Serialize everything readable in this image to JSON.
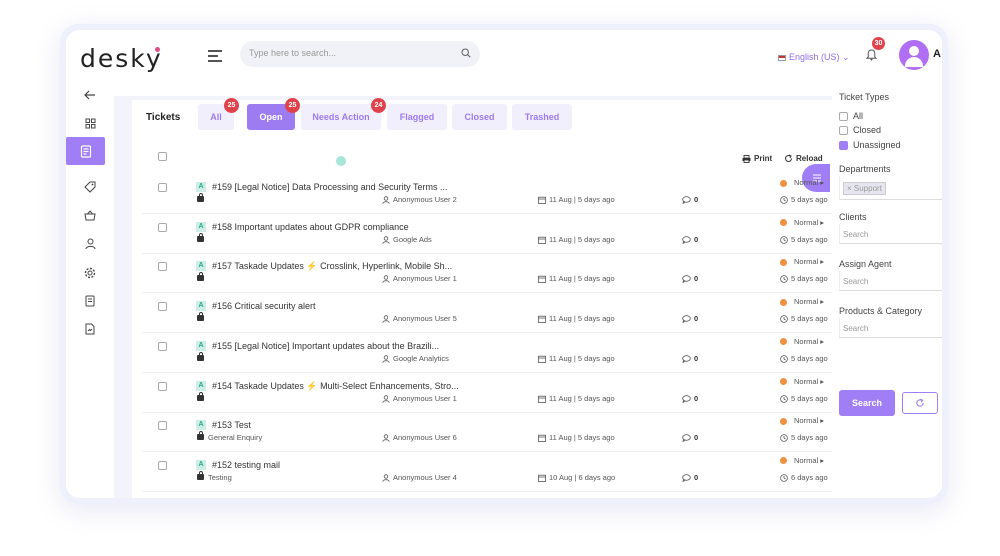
{
  "app": {
    "logo": "desky"
  },
  "header": {
    "search_placeholder": "Type here to search...",
    "language": "English (US)",
    "notification_count": "30",
    "user_initial": "A"
  },
  "tabs": {
    "label": "Tickets",
    "items": [
      {
        "label": "All",
        "badge": "25",
        "active": false
      },
      {
        "label": "Open",
        "badge": "25",
        "active": true
      },
      {
        "label": "Needs Action",
        "badge": "24",
        "active": false
      },
      {
        "label": "Flagged",
        "badge": "",
        "active": false
      },
      {
        "label": "Closed",
        "badge": "",
        "active": false
      },
      {
        "label": "Trashed",
        "badge": "",
        "active": false
      }
    ]
  },
  "toolbar": {
    "print": "Print",
    "reload": "Reload"
  },
  "tickets": [
    {
      "badge": "A",
      "title": "#159 [Legal Notice] Data Processing and Security Terms ...",
      "sub": "",
      "user": "Anonymous User 2",
      "date": "11 Aug | 5 days ago",
      "comments": "0",
      "priority": "Normal",
      "age": "5 days ago"
    },
    {
      "badge": "A",
      "title": "#158 Important updates about GDPR compliance",
      "sub": "",
      "user": "Google Ads",
      "date": "11 Aug | 5 days ago",
      "comments": "0",
      "priority": "Normal",
      "age": "5 days ago"
    },
    {
      "badge": "A",
      "title": "#157 Taskade Updates ⚡ Crosslink, Hyperlink, Mobile Sh...",
      "sub": "",
      "user": "Anonymous User 1",
      "date": "11 Aug | 5 days ago",
      "comments": "0",
      "priority": "Normal",
      "age": "5 days ago"
    },
    {
      "badge": "A",
      "title": "#156 Critical security alert",
      "sub": "",
      "user": "Anonymous User 5",
      "date": "11 Aug | 5 days ago",
      "comments": "0",
      "priority": "Normal",
      "age": "5 days ago"
    },
    {
      "badge": "A",
      "title": "#155 [Legal Notice] Important updates about the Brazili...",
      "sub": "",
      "user": "Google Analytics",
      "date": "11 Aug | 5 days ago",
      "comments": "0",
      "priority": "Normal",
      "age": "5 days ago"
    },
    {
      "badge": "A",
      "title": "#154 Taskade Updates ⚡ Multi-Select Enhancements, Stro...",
      "sub": "",
      "user": "Anonymous User 1",
      "date": "11 Aug | 5 days ago",
      "comments": "0",
      "priority": "Normal",
      "age": "5 days ago"
    },
    {
      "badge": "A",
      "title": "#153 Test",
      "sub": "General Enquiry",
      "user": "Anonymous User 6",
      "date": "11 Aug | 5 days ago",
      "comments": "0",
      "priority": "Normal",
      "age": "5 days ago"
    },
    {
      "badge": "A",
      "title": "#152 testing mail",
      "sub": "Testing",
      "user": "Anonymous User 4",
      "date": "10 Aug | 6 days ago",
      "comments": "0",
      "priority": "Normal",
      "age": "6 days ago"
    }
  ],
  "filters": {
    "ticket_types_label": "Ticket Types",
    "types": [
      {
        "label": "All",
        "checked": false
      },
      {
        "label": "Closed",
        "checked": false
      },
      {
        "label": "Unassigned",
        "checked": true
      }
    ],
    "departments_label": "Departments",
    "department_chip": "× Support",
    "clients_label": "Clients",
    "clients_placeholder": "Search",
    "agent_label": "Assign Agent",
    "agent_placeholder": "Search",
    "products_label": "Products & Category",
    "products_placeholder": "Search",
    "search_button": "Search"
  },
  "colors": {
    "accent": "#a07ef5",
    "badge_red": "#e0424b",
    "priority_orange": "#f0913f"
  }
}
